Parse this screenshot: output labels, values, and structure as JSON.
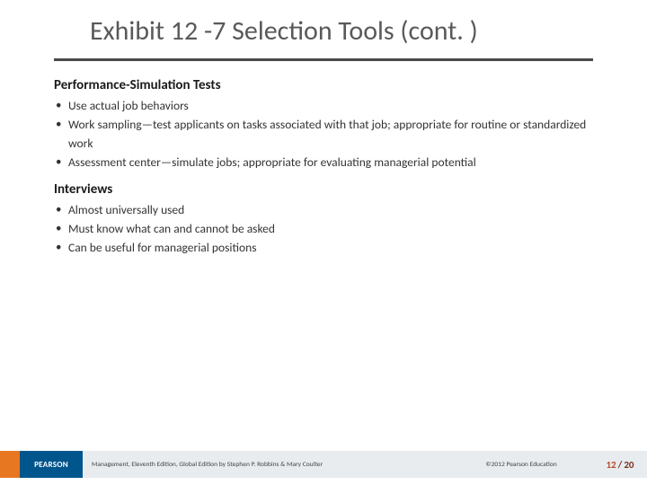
{
  "title": "Exhibit 12 -7 Selection Tools (cont. )",
  "sections": [
    {
      "heading": "Performance-Simulation Tests",
      "items": [
        "Use actual job behaviors",
        "Work sampling—test applicants on tasks associated with that job; appropriate for routine or standardized work",
        "Assessment center—simulate jobs; appropriate for evaluating managerial potential"
      ]
    },
    {
      "heading": "Interviews",
      "items": [
        "Almost universally used",
        "Must know what can and cannot be asked",
        "Can be useful for managerial positions"
      ]
    }
  ],
  "footer": {
    "logo": "PEARSON",
    "credit": "Management, Eleventh Edition, Global Edition by Stephen P. Robbins & Mary Coulter",
    "copyright": "©2012 Pearson Education",
    "page_current": "12",
    "page_sep": "/",
    "page_total": "20"
  }
}
